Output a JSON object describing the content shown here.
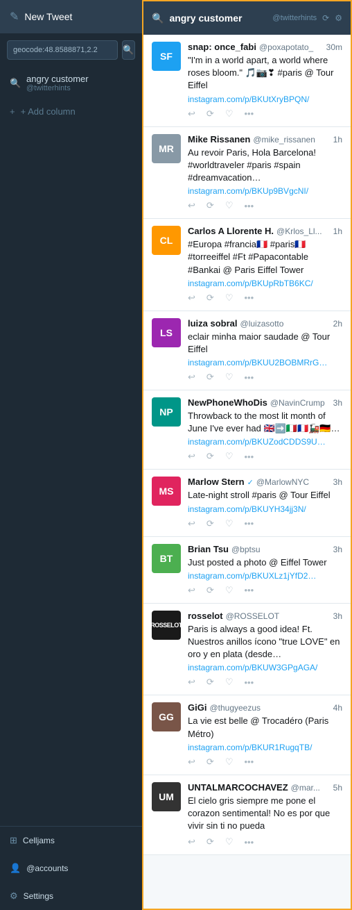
{
  "sidebar": {
    "header": {
      "icon": "✎",
      "title": "New Tweet"
    },
    "search": {
      "value": "geocode:48.8588871,2.2",
      "placeholder": "geocode:48.8588871,2.2"
    },
    "columns": [
      {
        "icon": "🔍",
        "label": "angry customer",
        "sub": "@twitterhints",
        "id": "angry-customer"
      }
    ],
    "add_column": "+ Add column",
    "footer": [
      {
        "icon": "⚙",
        "label": "Celljams",
        "id": "celljams"
      },
      {
        "icon": "👤",
        "label": "@accounts",
        "id": "accounts"
      },
      {
        "icon": "⚙",
        "label": "Settings",
        "id": "settings"
      }
    ]
  },
  "column": {
    "header": {
      "search_icon": "🔍",
      "title": "angry customer",
      "handle": "@twitterhints",
      "refresh_icon": "⟳"
    },
    "tweets": [
      {
        "id": "tweet-1",
        "avatar_initials": "SF",
        "avatar_color": "av-blue",
        "name": "snap: once_fabi",
        "handle": "@poxapotato_",
        "time": "30m",
        "text": "\"I'm in a world apart, a world where roses bloom.\" 🎵📷❣ #paris @ Tour Eiffel",
        "link": "instagram.com/p/BKUtXryBPQN/",
        "verified": false
      },
      {
        "id": "tweet-2",
        "avatar_initials": "MR",
        "avatar_color": "av-gray",
        "name": "Mike Rissanen",
        "handle": "@mike_rissanen",
        "time": "1h",
        "text": "Au revoir Paris, Hola Barcelona! #worldtraveler #paris #spain #dreamvacation…",
        "link": "instagram.com/p/BKUp9BVgcNI/",
        "verified": false
      },
      {
        "id": "tweet-3",
        "avatar_initials": "CL",
        "avatar_color": "av-orange",
        "name": "Carlos A Llorente H.",
        "handle": "@Krlos_Ll...",
        "time": "1h",
        "text": "#Europa #francia🇫🇷 #paris🇫🇷 #torreeiffel #Ft #Papacontable #Bankai @ Paris Eiffel Tower",
        "link": "instagram.com/p/BKUpRbTB6KC/",
        "verified": false
      },
      {
        "id": "tweet-4",
        "avatar_initials": "LS",
        "avatar_color": "av-purple",
        "name": "luiza sobral",
        "handle": "@luizasotto",
        "time": "2h",
        "text": "eclair minha maior saudade @ Tour Eiffel",
        "link": "instagram.com/p/BKUU2BOBMRrG…",
        "verified": false
      },
      {
        "id": "tweet-5",
        "avatar_initials": "NP",
        "avatar_color": "av-teal",
        "name": "NewPhoneWhoDis",
        "handle": "@NavinCrump",
        "time": "3h",
        "text": "Throwback to the most lit month of June I've ever had 🇬🇧➡️🇮🇹🇫🇷🚂🇩🇪…",
        "link": "instagram.com/p/BKUZodCDDS9U…",
        "verified": false
      },
      {
        "id": "tweet-6",
        "avatar_initials": "MS",
        "avatar_color": "av-red",
        "name": "Marlow Stern",
        "handle": "@MarlowNYC",
        "time": "3h",
        "text": "Late-night stroll #paris @ Tour Eiffel",
        "link": "instagram.com/p/BKUYH34jj3N/",
        "verified": true
      },
      {
        "id": "tweet-7",
        "avatar_initials": "BT",
        "avatar_color": "av-green",
        "name": "Brian Tsu",
        "handle": "@bptsu",
        "time": "3h",
        "text": "Just posted a photo @ Eiffel Tower",
        "link": "instagram.com/p/BKUXLz1jYfD2…",
        "verified": false
      },
      {
        "id": "tweet-8",
        "avatar_initials": "ROSSELOT",
        "avatar_color": "rosselot",
        "name": "rosselot",
        "handle": "@ROSSELOT",
        "time": "3h",
        "text": "Paris is always a good idea!\n\nFt.\nNuestros anillos ícono \"true LOVE\" en oro y en plata (desde…",
        "link": "instagram.com/p/BKUW3GPgAGA/",
        "verified": false
      },
      {
        "id": "tweet-9",
        "avatar_initials": "GG",
        "avatar_color": "av-brown",
        "name": "GiGi",
        "handle": "@thugyeezus",
        "time": "4h",
        "text": "La vie est belle @ Trocadéro (Paris Métro)",
        "link": "instagram.com/p/BKUR1RugqTB/",
        "verified": false
      },
      {
        "id": "tweet-10",
        "avatar_initials": "UM",
        "avatar_color": "av-black",
        "name": "UNTALMARCOCHAVEZ",
        "handle": "@mar...",
        "time": "5h",
        "text": "El cielo gris siempre me pone el corazon sentimental!\nNo es por que vivir sin ti no pueda",
        "link": "",
        "verified": false
      }
    ]
  }
}
